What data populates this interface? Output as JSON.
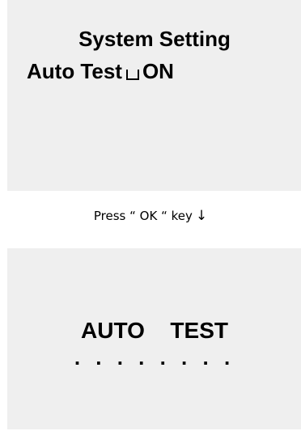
{
  "screen1": {
    "title": "System Setting",
    "setting_label": "Auto Test",
    "setting_value": "ON"
  },
  "caption": {
    "text": "Press “ OK “ key",
    "arrow": "↓"
  },
  "screen2": {
    "title": "AUTO  TEST",
    "progress": ". . . . . . . ."
  },
  "icons": {
    "space_glyph": "space-glyph-icon",
    "arrow": "arrow-down-icon"
  }
}
